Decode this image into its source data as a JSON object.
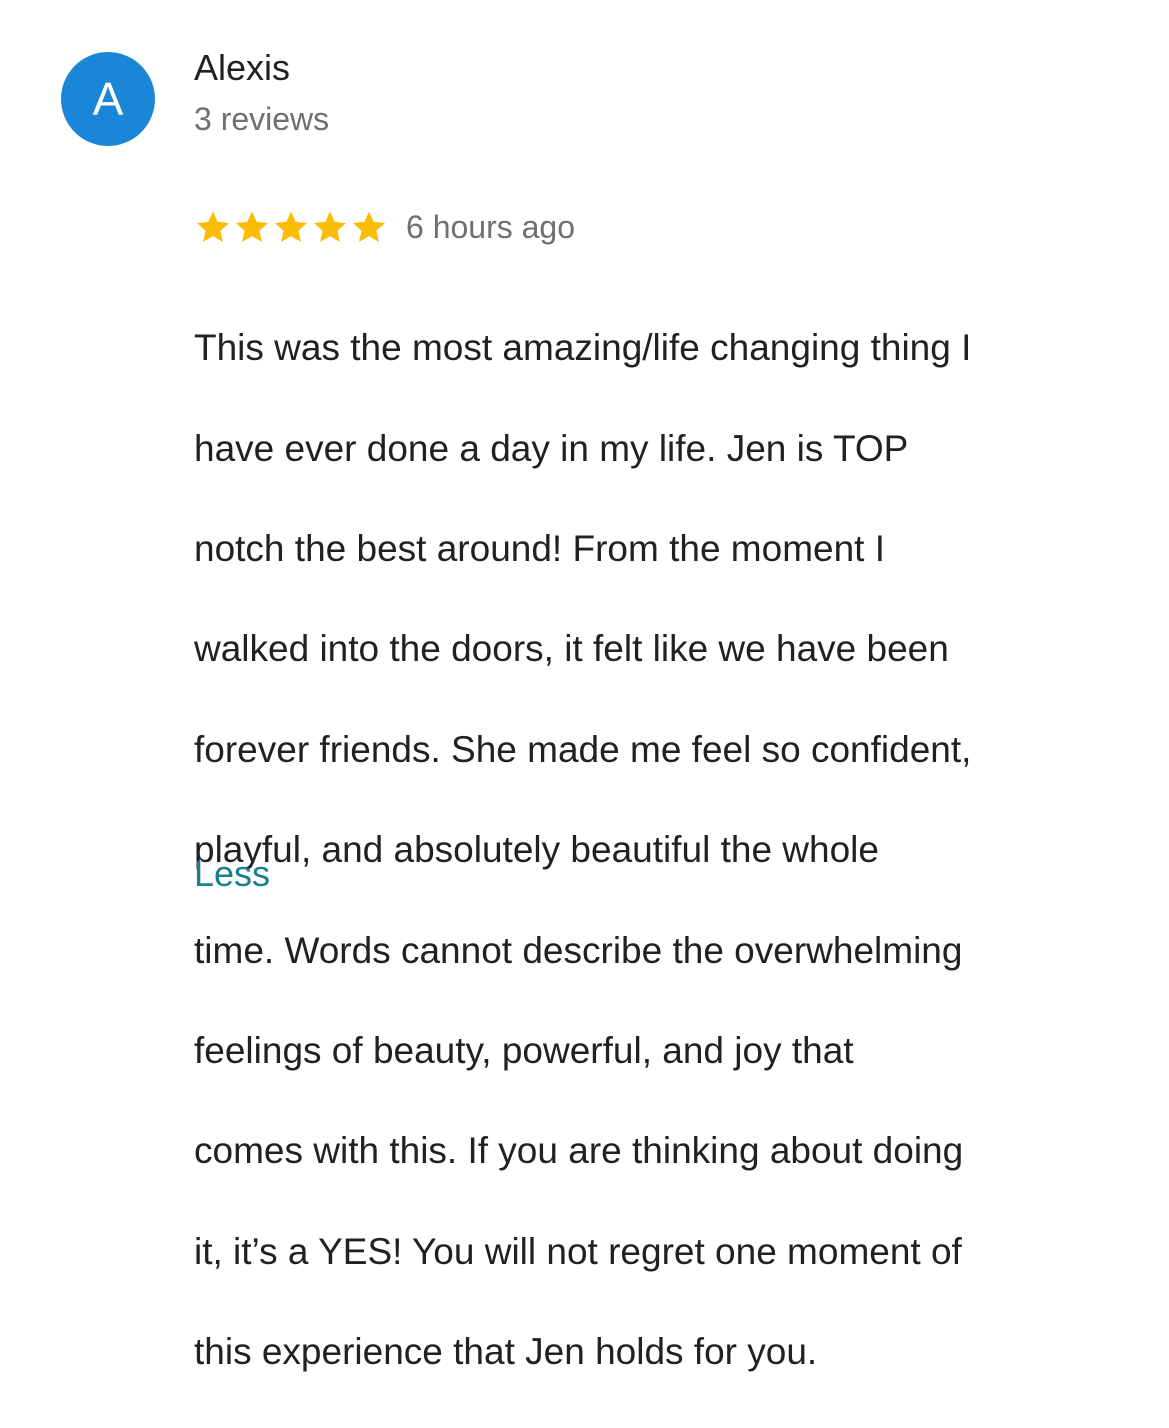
{
  "reviewer": {
    "avatar_letter": "A",
    "avatar_color": "#1a86d8",
    "name": "Alexis",
    "review_count": "3 reviews"
  },
  "review": {
    "rating": 5,
    "rating_max": 5,
    "star_color": "#fbbc04",
    "time": "6 hours ago",
    "lines": [
      "This was the most amazing/life changing thing I",
      "have ever done a day in my life. Jen is TOP",
      "notch the best around! From the moment I",
      "walked into the doors, it felt like we have been",
      "forever friends. She made me feel so confident,",
      "playful, and absolutely beautiful the whole",
      "time. Words cannot describe the overwhelming",
      "feelings of beauty, powerful, and joy that",
      "comes with this. If you are thinking about doing",
      "it, it’s a YES! You will not regret one moment of",
      "this experience that Jen holds for you."
    ],
    "less_label": "Less"
  }
}
